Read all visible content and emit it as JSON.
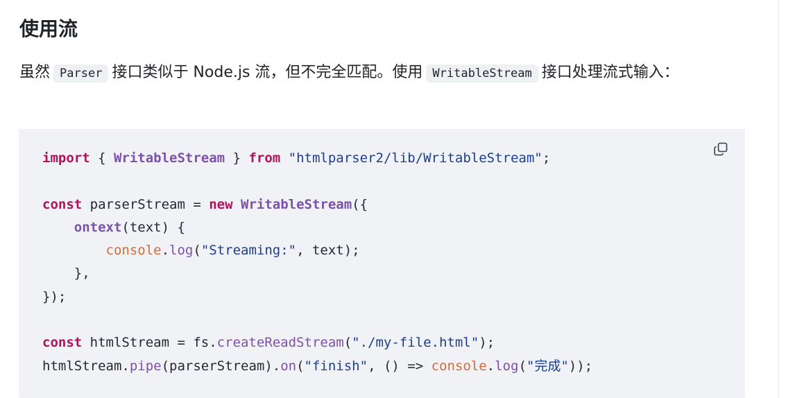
{
  "section": {
    "heading": "使用流",
    "para": {
      "t1": "虽然",
      "code1": "Parser",
      "t2": "接口类似于 Node.js 流，但不完全匹配。使用",
      "code2": "WritableStream",
      "t3": "接口处理流式输入："
    }
  },
  "code_block": {
    "copy_icon": "copy-icon",
    "tokens": {
      "import": "import",
      "lbrace_sp": " { ",
      "WritableStream": "WritableStream",
      "rbrace_sp": " } ",
      "from": "from",
      "module_path": "\"htmlparser2/lib/WritableStream\"",
      "semi": ";",
      "const": "const",
      "parserStream_decl": " parserStream = ",
      "new": "new",
      "open_obj": "({",
      "indent1": "    ",
      "ontext": "ontext",
      "ontext_sig": "(text) {",
      "indent2": "        ",
      "console": "console",
      "dot": ".",
      "log": "log",
      "lparen": "(",
      "streaming_str": "\"Streaming:\"",
      "log_args_tail": ", text);",
      "close_fn": "},",
      "close_obj": "});",
      "htmlStream_decl": " htmlStream = fs.",
      "createReadStream": "createReadStream",
      "file_str": "\"./my-file.html\"",
      "rparen_semi": ");",
      "htmlStream": "htmlStream",
      "pipe": "pipe",
      "pipe_arg": "(parserStream).",
      "on": "on",
      "finish_str": "\"finish\"",
      "arrow": ", () => ",
      "done_str": "\"完成\"",
      "end": "));"
    }
  }
}
